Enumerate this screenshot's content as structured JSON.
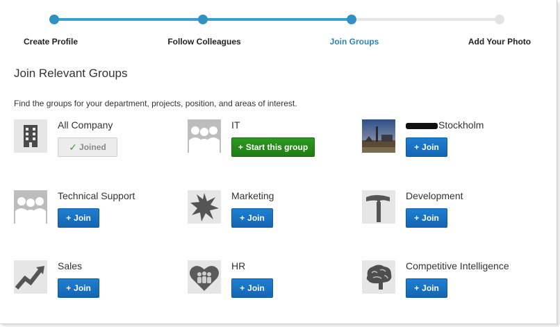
{
  "steps": [
    {
      "label": "Create Profile",
      "state": "done"
    },
    {
      "label": "Follow Colleagues",
      "state": "done"
    },
    {
      "label": "Join Groups",
      "state": "active"
    },
    {
      "label": "Add Your Photo",
      "state": "todo"
    }
  ],
  "heading": "Join Relevant Groups",
  "description": "Find the groups for your department, projects, position, and areas of interest.",
  "colors": {
    "accent": "#2b83b6",
    "join_button": "#1466b3",
    "start_button": "#1f7d13"
  },
  "buttons": {
    "join": "Join",
    "joined": "Joined",
    "start": "Start this group"
  },
  "groups": [
    {
      "name": "All Company",
      "icon": "building-icon",
      "action": "Joined"
    },
    {
      "name": "IT",
      "icon": "people-icon",
      "action": "Start this group"
    },
    {
      "name": "Stockholm",
      "icon": "city-photo",
      "action": "Join"
    },
    {
      "name": "Technical Support",
      "icon": "people-icon",
      "action": "Join"
    },
    {
      "name": "Marketing",
      "icon": "starburst-icon",
      "action": "Join"
    },
    {
      "name": "Development",
      "icon": "hammer-icon",
      "action": "Join"
    },
    {
      "name": "Sales",
      "icon": "rising-chart-icon",
      "action": "Join"
    },
    {
      "name": "HR",
      "icon": "heart-people-icon",
      "action": "Join"
    },
    {
      "name": "Competitive Intelligence",
      "icon": "brain-icon",
      "action": "Join"
    }
  ]
}
